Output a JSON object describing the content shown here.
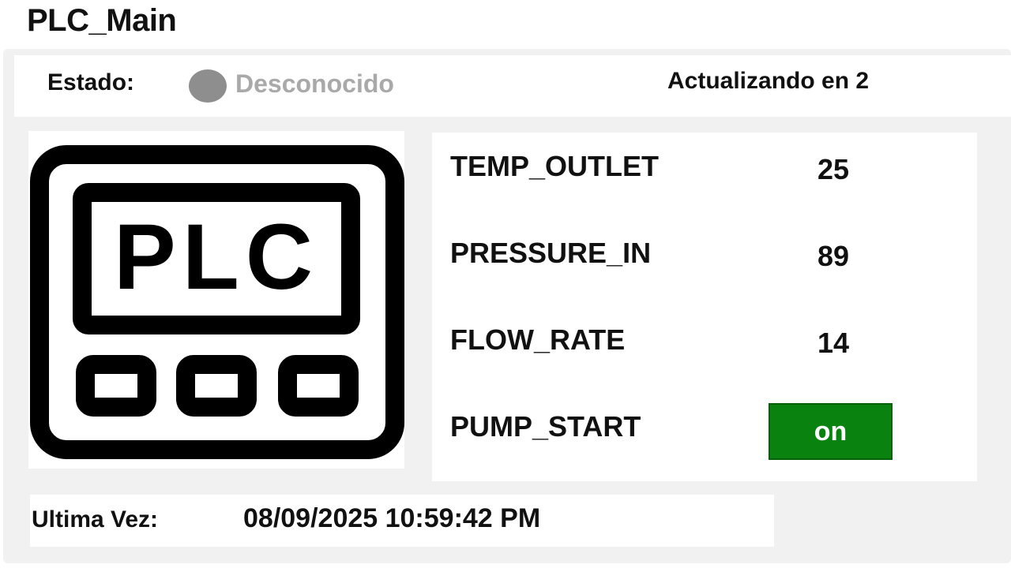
{
  "header": {
    "title": "PLC_Main"
  },
  "status": {
    "label": "Estado:",
    "value": "Desconocido",
    "indicator_color": "#8e8e8e",
    "refresh_text": "Actualizando en 2"
  },
  "device_icon": {
    "name": "plc-device-icon",
    "text": "PLC"
  },
  "tags": [
    {
      "name": "TEMP_OUTLET",
      "value": "25"
    },
    {
      "name": "PRESSURE_IN",
      "value": "89"
    },
    {
      "name": "FLOW_RATE",
      "value": "14"
    },
    {
      "name": "PUMP_START",
      "value": "on",
      "control": "toggle",
      "color": "#0a820f"
    }
  ],
  "footer": {
    "last_label": "Ultima Vez:",
    "last_value": "08/09/2025 10:59:42 PM"
  }
}
